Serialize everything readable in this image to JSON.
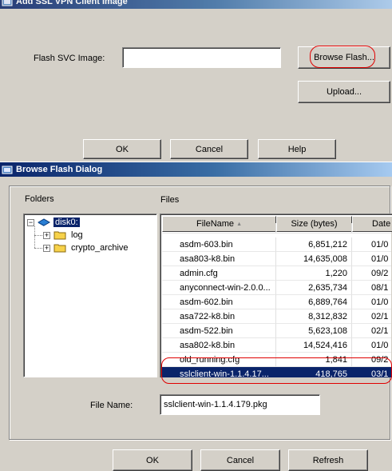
{
  "top_dialog": {
    "title": "Add SSL VPN Client Image",
    "flash_label": "Flash SVC Image:",
    "flash_value": "",
    "browse_label": "Browse Flash...",
    "upload_label": "Upload...",
    "ok_label": "OK",
    "cancel_label": "Cancel",
    "help_label": "Help"
  },
  "browse_dialog": {
    "title": "Browse Flash Dialog",
    "folders_label": "Folders",
    "files_label": "Files",
    "tree": {
      "root": "disk0:",
      "children": [
        "log",
        "crypto_archive"
      ]
    },
    "columns": {
      "name": "FileName",
      "sort_indicator": "▲",
      "size": "Size (bytes)",
      "date": "Date"
    },
    "files": [
      {
        "name": "",
        "size": "",
        "date": ""
      },
      {
        "name": "asdm-603.bin",
        "size": "6,851,212",
        "date": "01/0"
      },
      {
        "name": "asa803-k8.bin",
        "size": "14,635,008",
        "date": "01/0"
      },
      {
        "name": "admin.cfg",
        "size": "1,220",
        "date": "09/2"
      },
      {
        "name": "anyconnect-win-2.0.0...",
        "size": "2,635,734",
        "date": "08/1"
      },
      {
        "name": "asdm-602.bin",
        "size": "6,889,764",
        "date": "01/0"
      },
      {
        "name": "asa722-k8.bin",
        "size": "8,312,832",
        "date": "02/1"
      },
      {
        "name": "asdm-522.bin",
        "size": "5,623,108",
        "date": "02/1"
      },
      {
        "name": "asa802-k8.bin",
        "size": "14,524,416",
        "date": "01/0"
      },
      {
        "name": "old_running.cfg",
        "size": "1,841",
        "date": "09/2"
      },
      {
        "name": "sslclient-win-1.1.4.17...",
        "size": "418,765",
        "date": "03/1"
      }
    ],
    "selected_index": 10,
    "filename_label": "File Name:",
    "filename_value": "sslclient-win-1.1.4.179.pkg",
    "ok_label": "OK",
    "cancel_label": "Cancel",
    "refresh_label": "Refresh"
  },
  "colors": {
    "title_active": "#0a246a",
    "selection": "#0a246a",
    "highlight_annotation": "#e00000",
    "face": "#d4d0c8"
  }
}
